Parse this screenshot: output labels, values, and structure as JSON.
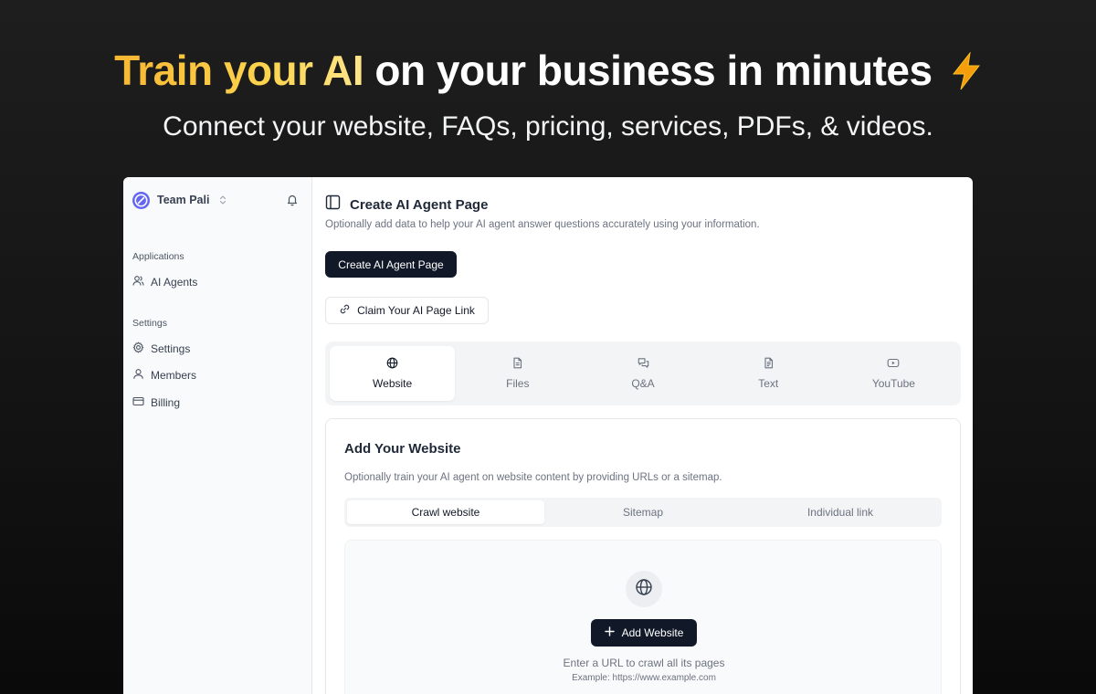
{
  "hero": {
    "title_accent": "Train your AI",
    "title_rest": "on your business in minutes",
    "subtitle": "Connect your website, FAQs, pricing, services, PDFs, & videos."
  },
  "colors": {
    "accent_gold": "#fbbf24",
    "dark_button": "#111827",
    "team_logo": "#6366f1"
  },
  "sidebar": {
    "team_name": "Team Pali",
    "groups": [
      {
        "label": "Applications",
        "items": [
          {
            "label": "AI Agents",
            "icon": "users-icon"
          }
        ]
      },
      {
        "label": "Settings",
        "items": [
          {
            "label": "Settings",
            "icon": "gear-icon"
          },
          {
            "label": "Members",
            "icon": "user-icon"
          },
          {
            "label": "Billing",
            "icon": "credit-card-icon"
          }
        ]
      }
    ]
  },
  "main": {
    "title": "Create AI Agent Page",
    "description": "Optionally add data to help your AI agent answer questions accurately using your information.",
    "primary_button": "Create AI Agent Page",
    "claim_button": "Claim Your AI Page Link",
    "tabs": [
      {
        "label": "Website",
        "icon": "globe-icon",
        "active": true
      },
      {
        "label": "Files",
        "icon": "file-icon"
      },
      {
        "label": "Q&A",
        "icon": "chat-icon"
      },
      {
        "label": "Text",
        "icon": "text-file-icon"
      },
      {
        "label": "YouTube",
        "icon": "youtube-icon"
      }
    ]
  },
  "website_card": {
    "title": "Add Your Website",
    "description": "Optionally train your AI agent on website content by providing URLs or a sitemap.",
    "subtabs": [
      {
        "label": "Crawl website",
        "active": true
      },
      {
        "label": "Sitemap"
      },
      {
        "label": "Individual link"
      }
    ],
    "add_button": "Add Website",
    "hint": "Enter a URL to crawl all its pages",
    "example": "Example: https://www.example.com"
  }
}
